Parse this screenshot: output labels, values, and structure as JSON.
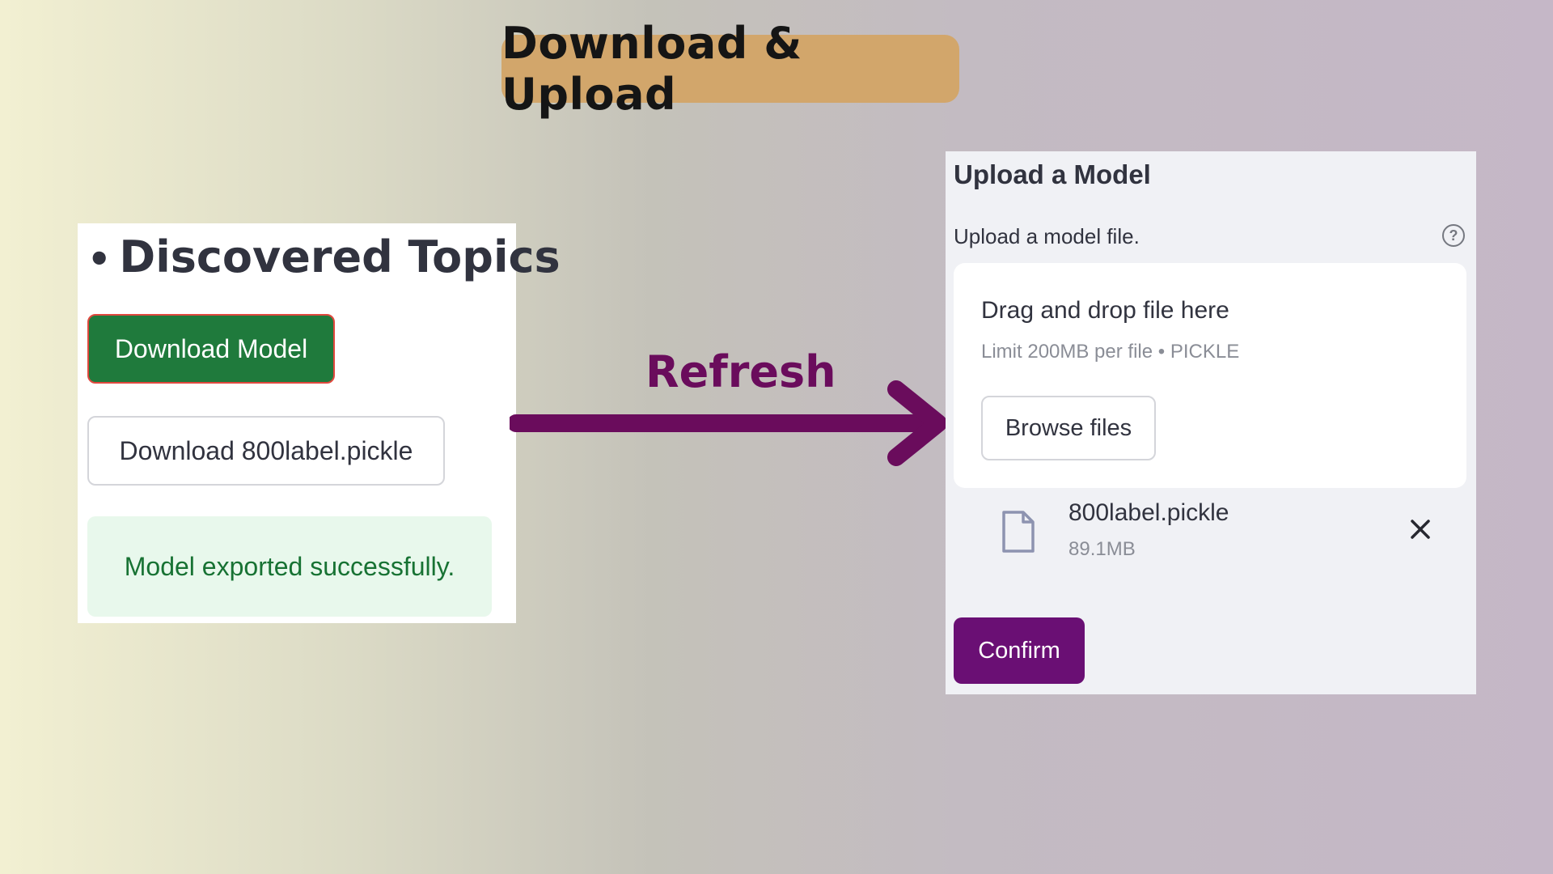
{
  "header": {
    "title": "Download & Upload"
  },
  "left_panel": {
    "heading_bullet": "•",
    "heading": "Discovered Topics",
    "download_model_label": "Download Model",
    "download_file_label": "Download 800label.pickle",
    "success_message": "Model exported successfully."
  },
  "transition": {
    "label": "Refresh",
    "arrow_color": "#6a0c5c"
  },
  "upload_panel": {
    "title": "Upload a Model",
    "field_label": "Upload a model file.",
    "help_icon_glyph": "?",
    "dropzone": {
      "instruction": "Drag and drop file here",
      "limit": "Limit 200MB per file • PICKLE",
      "browse_label": "Browse files"
    },
    "uploaded_file": {
      "icon": "file-icon",
      "name": "800label.pickle",
      "size": "89.1MB",
      "remove_icon": "close-icon"
    },
    "confirm_label": "Confirm"
  },
  "colors": {
    "title_pill": "#d2a66b",
    "primary_green": "#1f7a3c",
    "success_bg": "#e8f8ec",
    "confirm_purple": "#6a0f74",
    "accent_purple": "#6a0c5c"
  }
}
